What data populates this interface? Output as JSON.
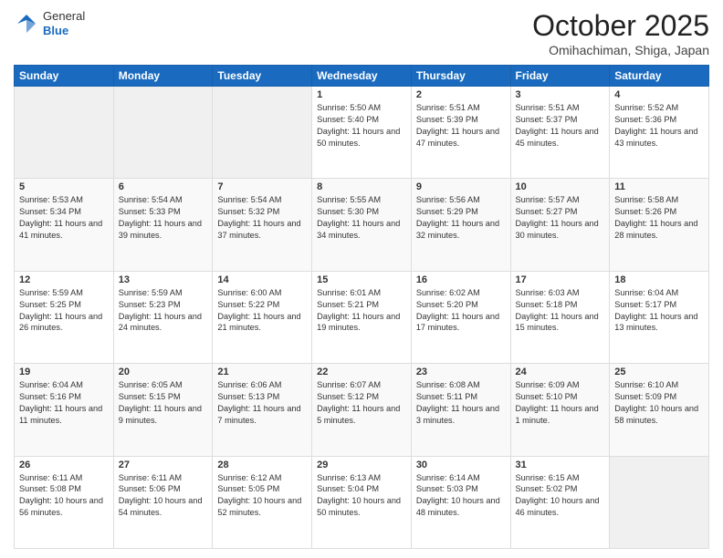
{
  "header": {
    "logo_line1": "General",
    "logo_line2": "Blue",
    "month": "October 2025",
    "location": "Omihachiman, Shiga, Japan"
  },
  "weekdays": [
    "Sunday",
    "Monday",
    "Tuesday",
    "Wednesday",
    "Thursday",
    "Friday",
    "Saturday"
  ],
  "weeks": [
    [
      {
        "day": "",
        "info": ""
      },
      {
        "day": "",
        "info": ""
      },
      {
        "day": "",
        "info": ""
      },
      {
        "day": "1",
        "info": "Sunrise: 5:50 AM\nSunset: 5:40 PM\nDaylight: 11 hours\nand 50 minutes."
      },
      {
        "day": "2",
        "info": "Sunrise: 5:51 AM\nSunset: 5:39 PM\nDaylight: 11 hours\nand 47 minutes."
      },
      {
        "day": "3",
        "info": "Sunrise: 5:51 AM\nSunset: 5:37 PM\nDaylight: 11 hours\nand 45 minutes."
      },
      {
        "day": "4",
        "info": "Sunrise: 5:52 AM\nSunset: 5:36 PM\nDaylight: 11 hours\nand 43 minutes."
      }
    ],
    [
      {
        "day": "5",
        "info": "Sunrise: 5:53 AM\nSunset: 5:34 PM\nDaylight: 11 hours\nand 41 minutes."
      },
      {
        "day": "6",
        "info": "Sunrise: 5:54 AM\nSunset: 5:33 PM\nDaylight: 11 hours\nand 39 minutes."
      },
      {
        "day": "7",
        "info": "Sunrise: 5:54 AM\nSunset: 5:32 PM\nDaylight: 11 hours\nand 37 minutes."
      },
      {
        "day": "8",
        "info": "Sunrise: 5:55 AM\nSunset: 5:30 PM\nDaylight: 11 hours\nand 34 minutes."
      },
      {
        "day": "9",
        "info": "Sunrise: 5:56 AM\nSunset: 5:29 PM\nDaylight: 11 hours\nand 32 minutes."
      },
      {
        "day": "10",
        "info": "Sunrise: 5:57 AM\nSunset: 5:27 PM\nDaylight: 11 hours\nand 30 minutes."
      },
      {
        "day": "11",
        "info": "Sunrise: 5:58 AM\nSunset: 5:26 PM\nDaylight: 11 hours\nand 28 minutes."
      }
    ],
    [
      {
        "day": "12",
        "info": "Sunrise: 5:59 AM\nSunset: 5:25 PM\nDaylight: 11 hours\nand 26 minutes."
      },
      {
        "day": "13",
        "info": "Sunrise: 5:59 AM\nSunset: 5:23 PM\nDaylight: 11 hours\nand 24 minutes."
      },
      {
        "day": "14",
        "info": "Sunrise: 6:00 AM\nSunset: 5:22 PM\nDaylight: 11 hours\nand 21 minutes."
      },
      {
        "day": "15",
        "info": "Sunrise: 6:01 AM\nSunset: 5:21 PM\nDaylight: 11 hours\nand 19 minutes."
      },
      {
        "day": "16",
        "info": "Sunrise: 6:02 AM\nSunset: 5:20 PM\nDaylight: 11 hours\nand 17 minutes."
      },
      {
        "day": "17",
        "info": "Sunrise: 6:03 AM\nSunset: 5:18 PM\nDaylight: 11 hours\nand 15 minutes."
      },
      {
        "day": "18",
        "info": "Sunrise: 6:04 AM\nSunset: 5:17 PM\nDaylight: 11 hours\nand 13 minutes."
      }
    ],
    [
      {
        "day": "19",
        "info": "Sunrise: 6:04 AM\nSunset: 5:16 PM\nDaylight: 11 hours\nand 11 minutes."
      },
      {
        "day": "20",
        "info": "Sunrise: 6:05 AM\nSunset: 5:15 PM\nDaylight: 11 hours\nand 9 minutes."
      },
      {
        "day": "21",
        "info": "Sunrise: 6:06 AM\nSunset: 5:13 PM\nDaylight: 11 hours\nand 7 minutes."
      },
      {
        "day": "22",
        "info": "Sunrise: 6:07 AM\nSunset: 5:12 PM\nDaylight: 11 hours\nand 5 minutes."
      },
      {
        "day": "23",
        "info": "Sunrise: 6:08 AM\nSunset: 5:11 PM\nDaylight: 11 hours\nand 3 minutes."
      },
      {
        "day": "24",
        "info": "Sunrise: 6:09 AM\nSunset: 5:10 PM\nDaylight: 11 hours\nand 1 minute."
      },
      {
        "day": "25",
        "info": "Sunrise: 6:10 AM\nSunset: 5:09 PM\nDaylight: 10 hours\nand 58 minutes."
      }
    ],
    [
      {
        "day": "26",
        "info": "Sunrise: 6:11 AM\nSunset: 5:08 PM\nDaylight: 10 hours\nand 56 minutes."
      },
      {
        "day": "27",
        "info": "Sunrise: 6:11 AM\nSunset: 5:06 PM\nDaylight: 10 hours\nand 54 minutes."
      },
      {
        "day": "28",
        "info": "Sunrise: 6:12 AM\nSunset: 5:05 PM\nDaylight: 10 hours\nand 52 minutes."
      },
      {
        "day": "29",
        "info": "Sunrise: 6:13 AM\nSunset: 5:04 PM\nDaylight: 10 hours\nand 50 minutes."
      },
      {
        "day": "30",
        "info": "Sunrise: 6:14 AM\nSunset: 5:03 PM\nDaylight: 10 hours\nand 48 minutes."
      },
      {
        "day": "31",
        "info": "Sunrise: 6:15 AM\nSunset: 5:02 PM\nDaylight: 10 hours\nand 46 minutes."
      },
      {
        "day": "",
        "info": ""
      }
    ]
  ]
}
